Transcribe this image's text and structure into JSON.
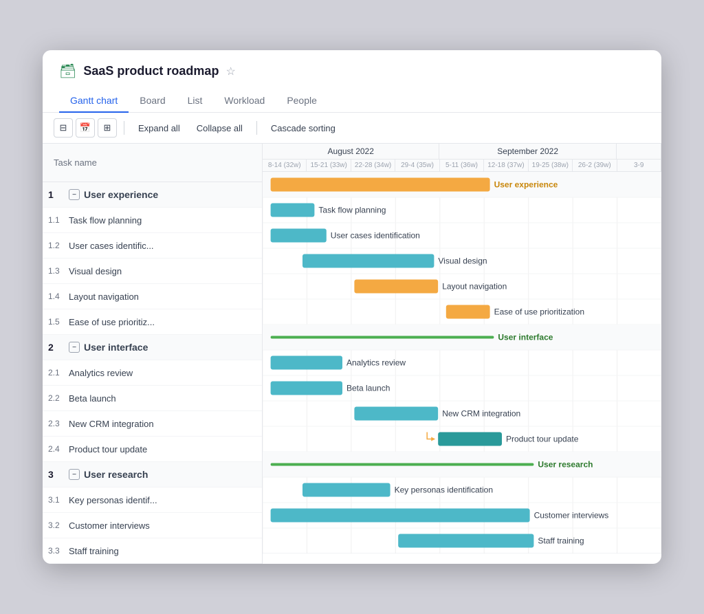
{
  "app": {
    "title": "SaaS product roadmap",
    "title_icon": "🗃",
    "star_label": "☆"
  },
  "nav": {
    "tabs": [
      "Gantt chart",
      "Board",
      "List",
      "Workload",
      "People"
    ],
    "active": "Gantt chart"
  },
  "toolbar": {
    "expand_all": "Expand all",
    "collapse_all": "Collapse all",
    "cascade_sorting": "Cascade sorting"
  },
  "task_panel": {
    "header": "Task name",
    "groups": [
      {
        "num": "1",
        "name": "User experience",
        "tasks": [
          {
            "num": "1.1",
            "name": "Task flow planning"
          },
          {
            "num": "1.2",
            "name": "User cases identific..."
          },
          {
            "num": "1.3",
            "name": "Visual design"
          },
          {
            "num": "1.4",
            "name": "Layout navigation"
          },
          {
            "num": "1.5",
            "name": "Ease of use prioritiz..."
          }
        ]
      },
      {
        "num": "2",
        "name": "User interface",
        "tasks": [
          {
            "num": "2.1",
            "name": "Analytics review"
          },
          {
            "num": "2.2",
            "name": "Beta launch"
          },
          {
            "num": "2.3",
            "name": "New CRM integration"
          },
          {
            "num": "2.4",
            "name": "Product tour update"
          }
        ]
      },
      {
        "num": "3",
        "name": "User research",
        "tasks": [
          {
            "num": "3.1",
            "name": "Key personas identif..."
          },
          {
            "num": "3.2",
            "name": "Customer interviews"
          },
          {
            "num": "3.3",
            "name": "Staff training"
          }
        ]
      }
    ]
  },
  "chart": {
    "months": [
      {
        "label": "August 2022",
        "span": 4
      },
      {
        "label": "September 2022",
        "span": 4
      },
      {
        "label": "",
        "span": 1
      }
    ],
    "weeks": [
      "8-14 (32w)",
      "15-21 (33w)",
      "22-28 (34w)",
      "29-4 (35w)",
      "5-11 (36w)",
      "12-18 (37w)",
      "19-25 (38w)",
      "26-2 (39w)",
      "3-9"
    ],
    "bars": {
      "user_experience_group": {
        "left_pct": 1.5,
        "width_pct": 55,
        "label": "User experience",
        "type": "orange",
        "is_group": true
      },
      "task_flow": {
        "left_pct": 1.5,
        "width_pct": 11,
        "label": "Task flow planning",
        "type": "teal"
      },
      "user_cases": {
        "left_pct": 1.5,
        "width_pct": 14,
        "label": "User cases identification",
        "type": "teal"
      },
      "visual_design": {
        "left_pct": 10,
        "width_pct": 33,
        "label": "Visual design",
        "type": "teal"
      },
      "layout_nav": {
        "left_pct": 22,
        "width_pct": 22,
        "label": "Layout navigation",
        "type": "orange"
      },
      "ease_of_use": {
        "left_pct": 44,
        "width_pct": 12,
        "label": "Ease of use prioritization",
        "type": "orange"
      },
      "user_interface_group": {
        "left_pct": 1.5,
        "width_pct": 56,
        "label": "User interface",
        "type": "green_line",
        "is_group": true
      },
      "analytics": {
        "left_pct": 1.5,
        "width_pct": 18,
        "label": "Analytics review",
        "type": "teal"
      },
      "beta_launch": {
        "left_pct": 1.5,
        "width_pct": 18,
        "label": "Beta launch",
        "type": "teal"
      },
      "new_crm": {
        "left_pct": 22,
        "width_pct": 22,
        "label": "New CRM integration",
        "type": "teal"
      },
      "product_tour": {
        "left_pct": 44,
        "width_pct": 15,
        "label": "Product tour update",
        "type": "dark_teal"
      },
      "user_research_group": {
        "left_pct": 1.5,
        "width_pct": 67,
        "label": "User research",
        "type": "green_line",
        "is_group": true
      },
      "key_personas": {
        "left_pct": 10,
        "width_pct": 22,
        "label": "Key personas identification",
        "type": "teal"
      },
      "customer_int": {
        "left_pct": 1.5,
        "width_pct": 65,
        "label": "Customer interviews",
        "type": "teal"
      },
      "staff_training": {
        "left_pct": 33,
        "width_pct": 34,
        "label": "Staff training",
        "type": "teal"
      }
    }
  },
  "colors": {
    "teal": "#4db8c8",
    "orange": "#f4a942",
    "green": "#4caf50",
    "dark_teal": "#2a9a9a",
    "accent_blue": "#2563eb"
  }
}
